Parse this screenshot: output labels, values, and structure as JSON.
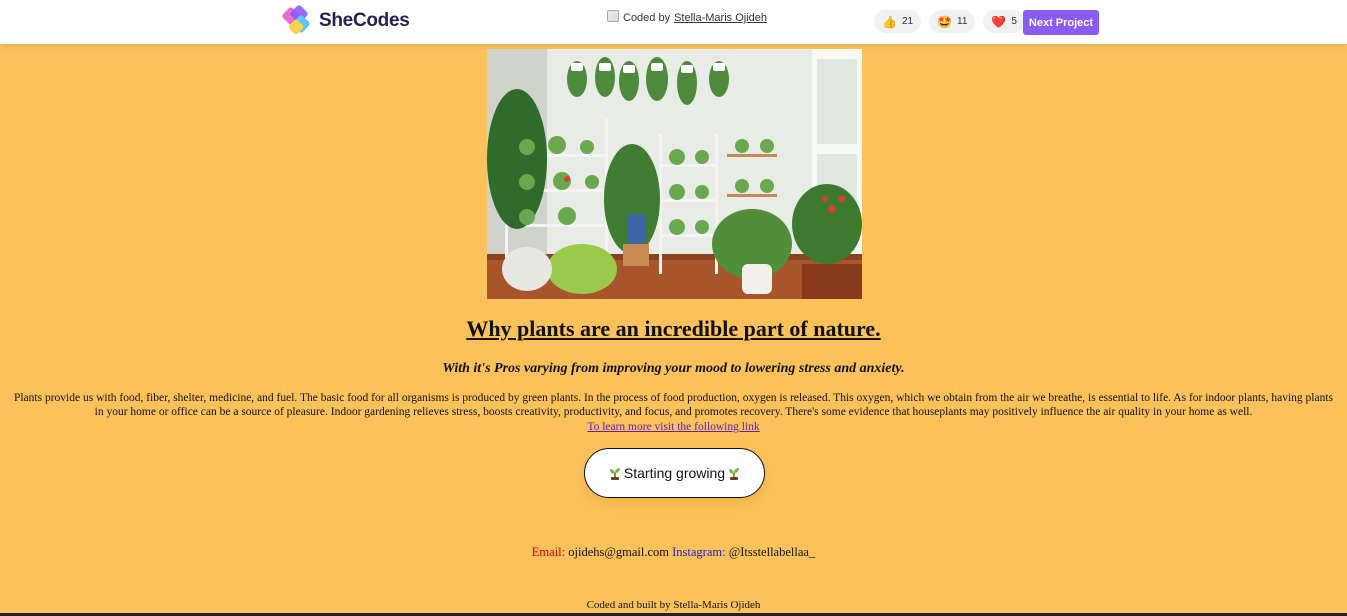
{
  "topbar": {
    "brand_name": "SheCodes",
    "credit_prefix": "Coded by",
    "credit_author": "Stella-Maris Ojideh",
    "reactions": [
      {
        "icon": "thumbs-up-icon",
        "emoji": "👍",
        "count": "21"
      },
      {
        "icon": "star-struck-icon",
        "emoji": "🤩",
        "count": "11"
      },
      {
        "icon": "heart-icon",
        "emoji": "❤️",
        "count": "5"
      }
    ],
    "next_label": "Next Project"
  },
  "main": {
    "hero_icon": "indoor-plants-photo",
    "title": "Why plants are an incredible part of nature.",
    "subtitle": "With it's Pros varying from improving your mood to lowering stress and anxiety.",
    "body": "Plants provide us with food, fiber, shelter, medicine, and fuel. The basic food for all organisms is produced by green plants. In the process of food production, oxygen is released. This oxygen, which we obtain from the air we breathe, is essential to life. As for indoor plants, having plants in your home or office can be a source of pleasure. Indoor gardening relieves stress, boosts creativity, productivity, and focus, and promotes recovery. There's some evidence that houseplants may positively influence the air quality in your home as well.",
    "link_text": "To learn more visit the following link",
    "button_label": "Starting growing",
    "button_icon": "seedling-icon"
  },
  "contact": {
    "email_label": "Email:",
    "email_value": "ojidehs@gmail.com",
    "instagram_label": "Instagram:",
    "instagram_value": "@Itsstellabellaa_"
  },
  "footer": {
    "text": "Coded and built by Stella-Maris Ojideh"
  },
  "colors": {
    "background": "#fbc25c",
    "accent": "#8a5cf5",
    "email_label": "#d40000",
    "instagram_label": "#1d1dcc"
  }
}
